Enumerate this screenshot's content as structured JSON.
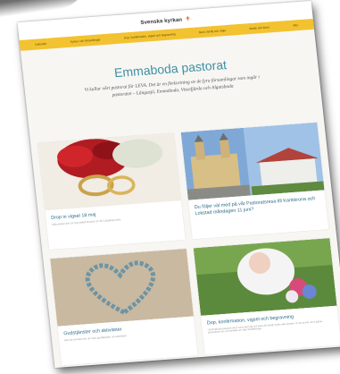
{
  "site": {
    "logo_text": "Svenska kyrkan",
    "logo_icon": "cross-flame-icon",
    "accent": "#f2c230",
    "title_color": "#3d8fa4"
  },
  "nav": {
    "items": [
      "Kalender",
      "Kyrkor och församlingar",
      "Dop, konfirmation, vigsel och begravning",
      "Barn, familj och unga",
      "Musik och körer",
      "Mer"
    ]
  },
  "hero": {
    "title": "Emmaboda pastorat",
    "text": "Vi kallar vårt pastorat för LEVA. Det är en förkortning av de fyra församlingar som ingår i pastoratet – Långasjö, Emmaboda, Vissefjärda och Algutsboda"
  },
  "cards": [
    {
      "title": "Drop in vigsel 18 maj",
      "sub": "Välkommen den 18 maj mellan klockan 11-18 i Långasjö kyrka",
      "image": "wedding-rings"
    },
    {
      "title": "Du följer väl med på vår Pastoratsresa till Karlskrona och Lokstad måndagen 11 juni?",
      "sub": "",
      "image": "churches"
    },
    {
      "title": "Gudstjänster och aktiviteter",
      "sub": "Här kan du läsa mer om våra gudstjänster och aktiviteter",
      "image": "stone-heart"
    },
    {
      "title": "Dop, konfirmation, vigsel och begravning",
      "sub": "I Emmaboda pastorat vill vi vara med dig och hela din familj i livets alla skeden. Är du ny här vill vi gärna presentera oss och berätta om våra förrättningar.",
      "image": "baptism"
    }
  ]
}
